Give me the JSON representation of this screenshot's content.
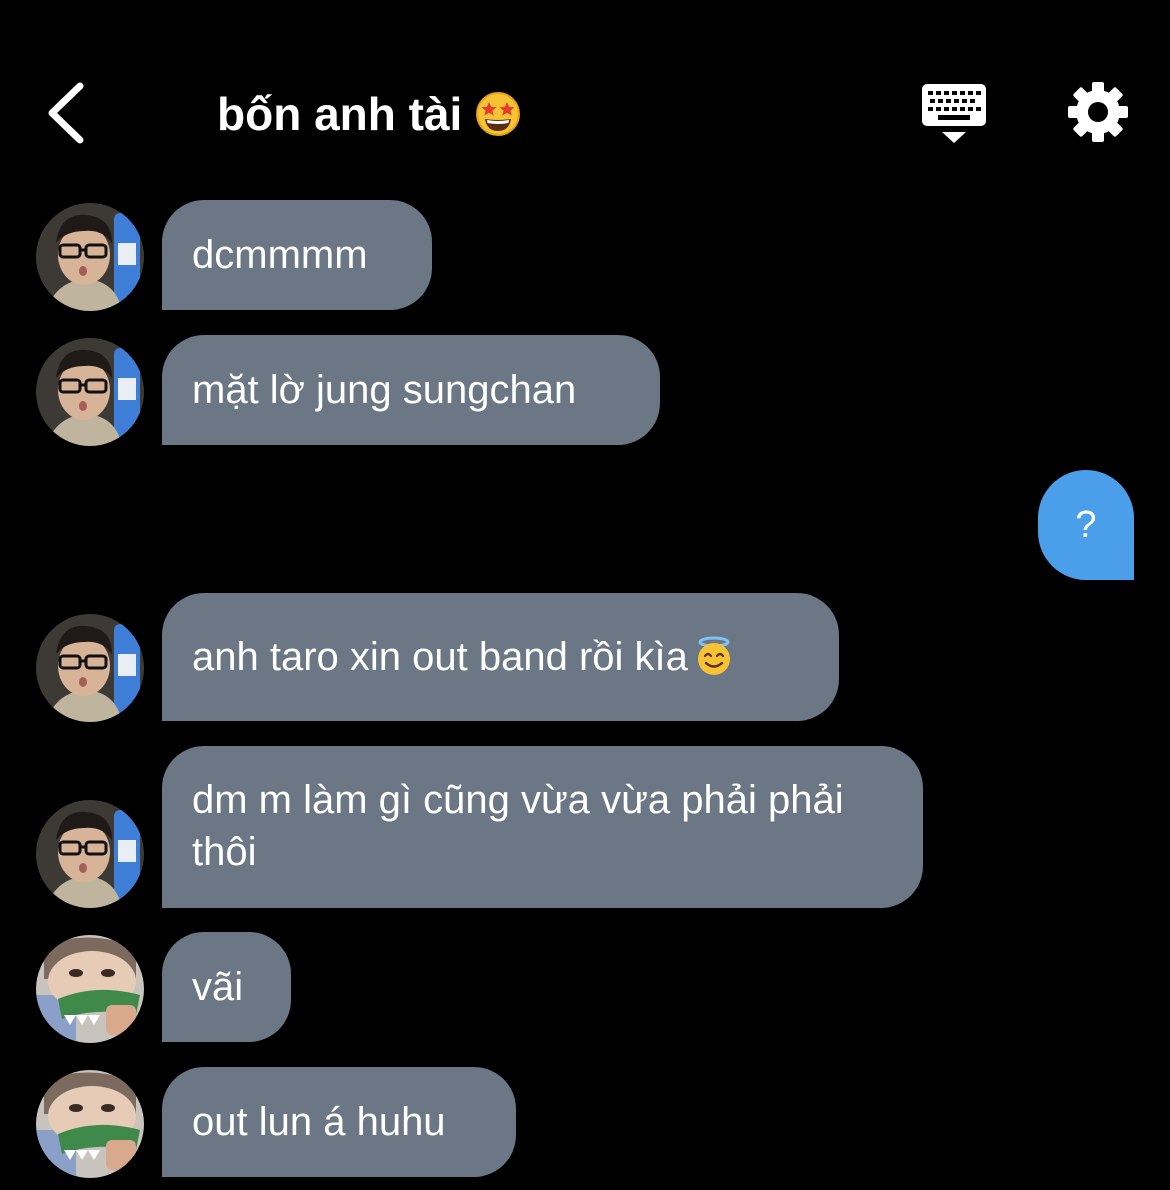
{
  "header": {
    "back_icon": "chevron-left-icon",
    "title": "bốn anh tài",
    "title_emoji": "star-struck-emoji",
    "keyboard_icon": "keyboard-icon",
    "settings_icon": "gear-icon"
  },
  "colors": {
    "background": "#000000",
    "incoming_bubble": "#6b7784",
    "outgoing_bubble": "#4b9eea",
    "text": "#ffffff"
  },
  "messages": [
    {
      "sender": "other",
      "avatar": "avatar-person-glasses",
      "text": "dcmmmm"
    },
    {
      "sender": "other",
      "avatar": "avatar-person-glasses",
      "text": "mặt lờ jung sungchan"
    },
    {
      "sender": "me",
      "text": "?"
    },
    {
      "sender": "other",
      "avatar": "avatar-person-glasses",
      "text": "anh taro xin out band rồi kìa",
      "emoji": "smiling-face-with-halo-emoji"
    },
    {
      "sender": "other",
      "avatar": "avatar-person-glasses",
      "text": "dm m làm gì cũng vừa vừa phải phải thôi"
    },
    {
      "sender": "other",
      "avatar": "avatar-person-crocodile",
      "text": "vãi"
    },
    {
      "sender": "other",
      "avatar": "avatar-person-crocodile",
      "text": "out lun á huhu"
    }
  ]
}
